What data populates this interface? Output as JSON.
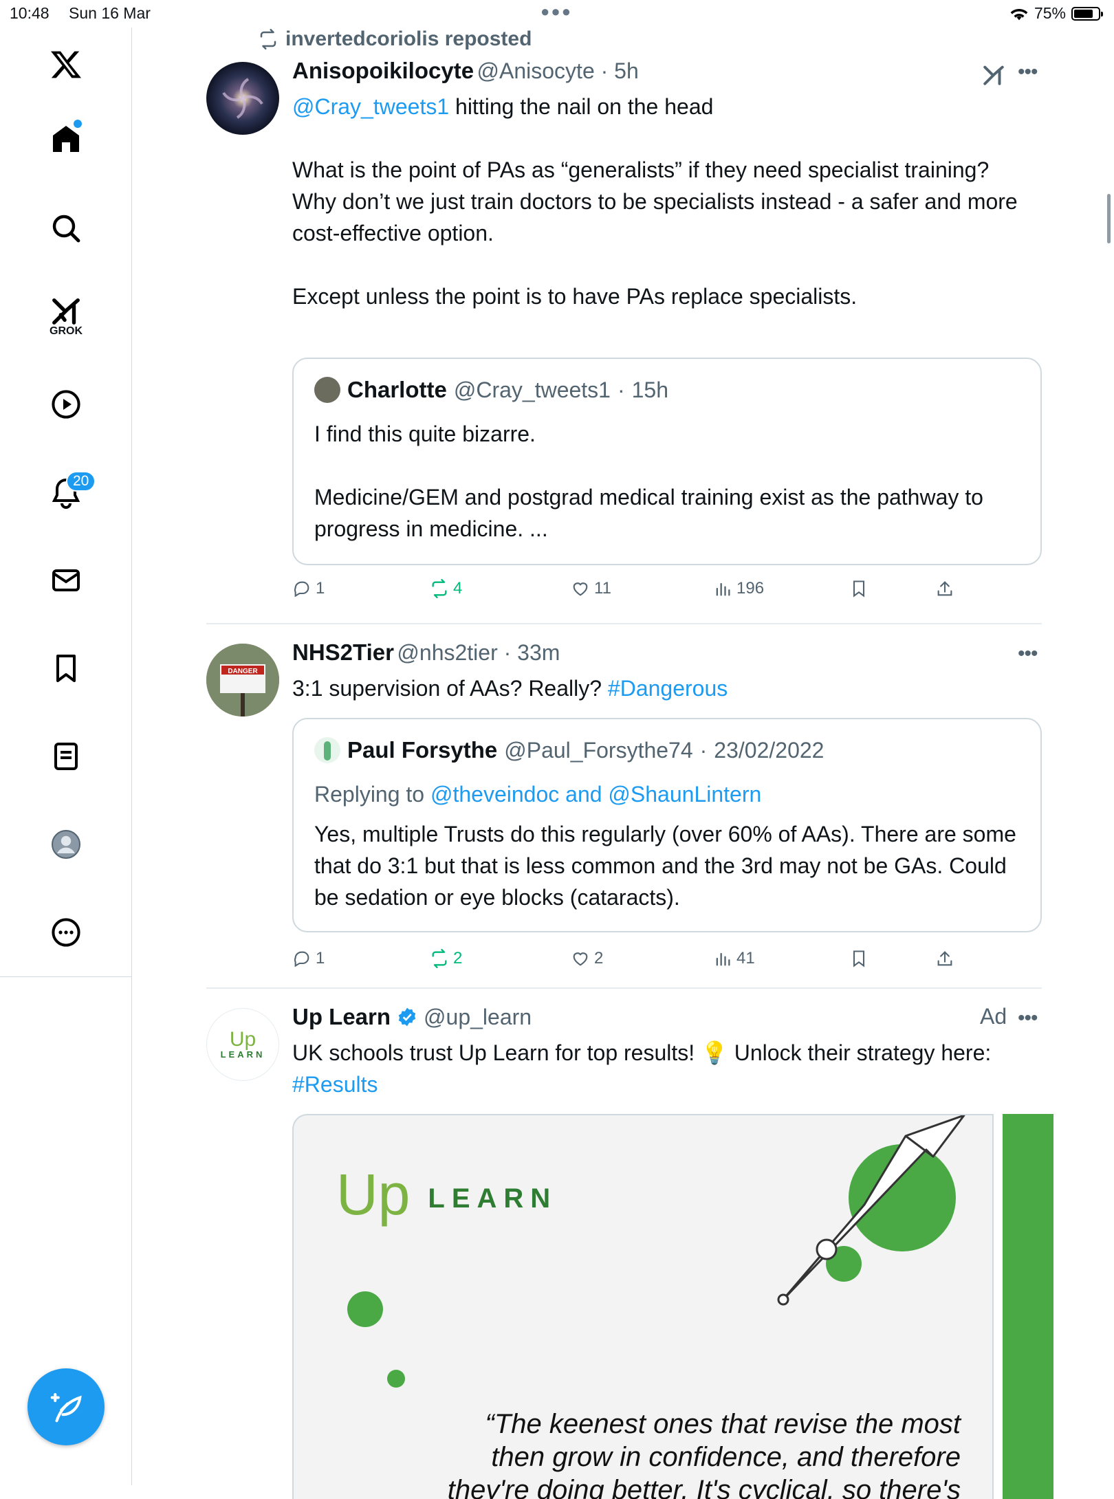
{
  "status_bar": {
    "time": "10:48",
    "date": "Sun 16 Mar",
    "battery": "75%"
  },
  "sidebar": {
    "items": [
      {
        "name": "x-logo-icon"
      },
      {
        "name": "home-icon"
      },
      {
        "name": "search-icon"
      },
      {
        "name": "grok-icon",
        "label": "GROK"
      },
      {
        "name": "video-play-icon"
      },
      {
        "name": "notifications-bell-icon",
        "badge": "20"
      },
      {
        "name": "messages-envelope-icon"
      },
      {
        "name": "bookmarks-icon"
      },
      {
        "name": "lists-icon"
      },
      {
        "name": "profile-icon"
      },
      {
        "name": "more-circle-icon"
      }
    ],
    "compose": "compose-feather-icon"
  },
  "tweets": [
    {
      "repost_label": "invertedcoriolis reposted",
      "name": "Anisopoikilocyte",
      "handle": "@Anisocyte",
      "time": "5h",
      "mention": "@Cray_tweets1",
      "line1": " hitting the nail on the head",
      "para1": "What is the point of PAs as “generalists” if they need specialist training?",
      "para2": "Why don’t we just train doctors to be specialists instead - a safer and more cost-effective option.",
      "para3": "Except unless the point is to have PAs replace specialists.",
      "quote": {
        "name": "Charlotte",
        "handle": "@Cray_tweets1",
        "time": "15h",
        "line1": "I find this quite bizarre.",
        "line2": "Medicine/GEM and postgrad medical training exist as the pathway to progress in medicine. ..."
      },
      "actions": {
        "replies": "1",
        "reposts": "4",
        "likes": "11",
        "views": "196"
      }
    },
    {
      "name": "NHS2Tier",
      "handle": "@nhs2tier",
      "time": "33m",
      "text": "3:1 supervision of AAs? Really? ",
      "hashtag": "#Dangerous",
      "quote": {
        "name": "Paul Forsythe",
        "handle": "@Paul_Forsythe74",
        "time": "23/02/2022",
        "replying_prefix": "Replying to ",
        "replying_to": "@theveindoc and @ShaunLintern",
        "text": "Yes, multiple Trusts do this regularly (over 60% of AAs). There are some that do 3:1 but that is less common and the 3rd may not be GAs. Could be sedation or eye blocks (cataracts)."
      },
      "actions": {
        "replies": "1",
        "reposts": "2",
        "likes": "2",
        "views": "41"
      }
    },
    {
      "name": "Up Learn",
      "handle": "@up_learn",
      "ad_label": "Ad",
      "text": "UK schools trust Up Learn for top results! 💡 Unlock their strategy here: ",
      "hashtag": "#Results",
      "avatar_logo": {
        "top": "Up",
        "bottom": "LEARN"
      },
      "media": {
        "logo_up": "Up",
        "logo_learn": "LEARN",
        "quote_l1": "“The keenest ones that revise the most",
        "quote_l2": "then grow in confidence, and therefore",
        "quote_l3": "they're doing better. It's cyclical, so there's"
      }
    }
  ],
  "colors": {
    "accent": "#1d9bf0",
    "repost_green": "#00ba7c",
    "uplearn_green": "#4aa944",
    "muted": "#536471"
  }
}
